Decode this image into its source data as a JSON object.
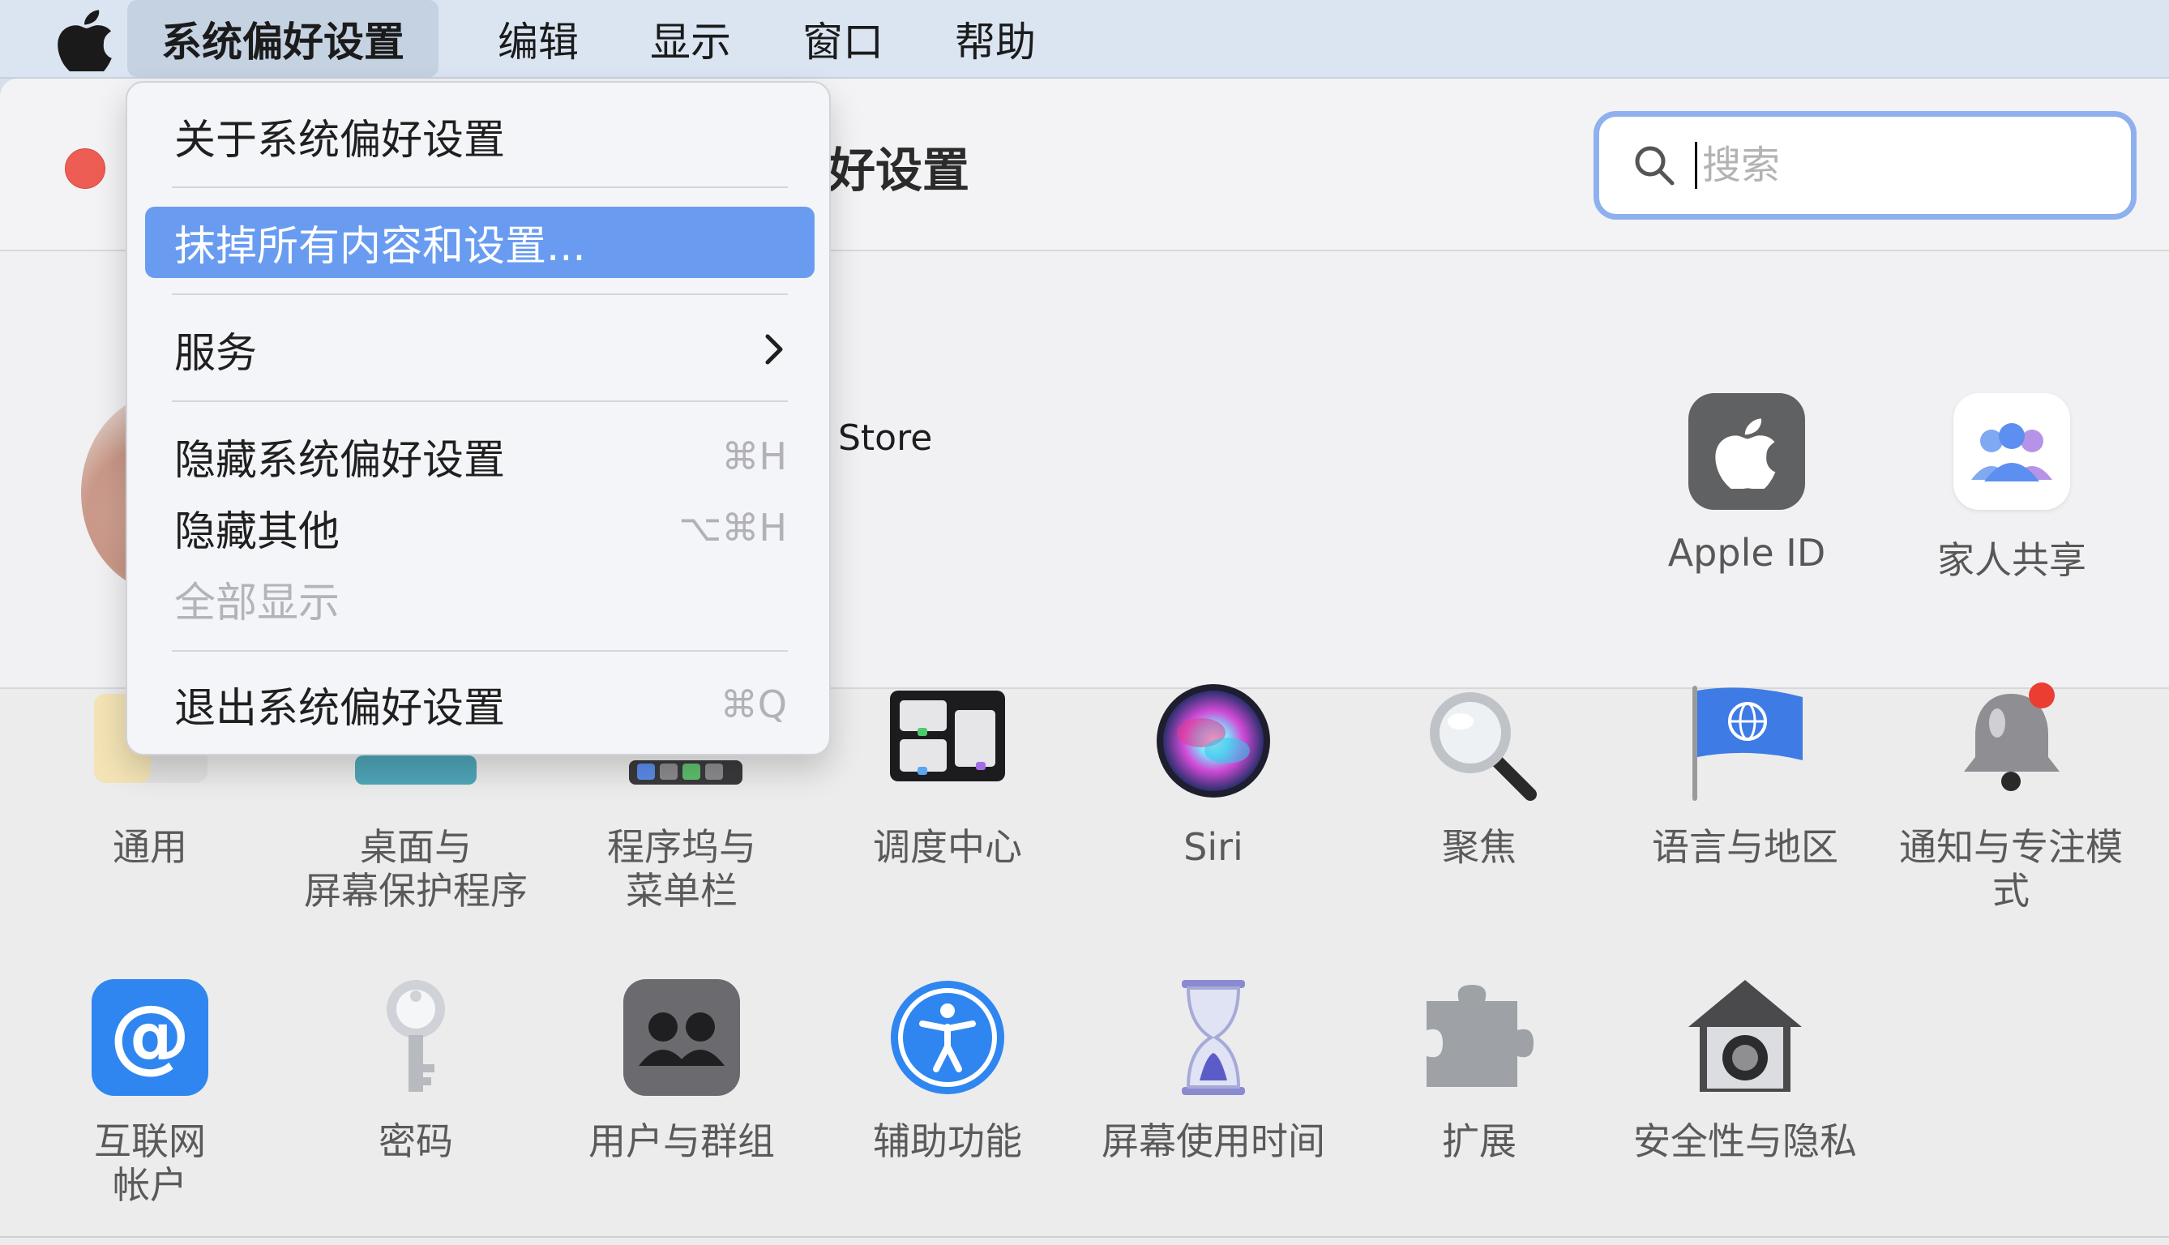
{
  "menubar": {
    "app_name": "系统偏好设置",
    "edit": "编辑",
    "view": "显示",
    "window": "窗口",
    "help": "帮助"
  },
  "window": {
    "title": "好设置",
    "search_placeholder": "搜索",
    "store_text": "Store"
  },
  "top_items": [
    {
      "label": "Apple ID",
      "icon": "apple-icon"
    },
    {
      "label": "家人共享",
      "icon": "family-sharing-icon"
    }
  ],
  "grid_row1": [
    {
      "label": "通用",
      "icon": "general-icon"
    },
    {
      "label": "桌面与\n屏幕保护程序",
      "icon": "desktop-screensaver-icon"
    },
    {
      "label": "程序坞与\n菜单栏",
      "icon": "dock-menubar-icon"
    },
    {
      "label": "调度中心",
      "icon": "mission-control-icon"
    },
    {
      "label": "Siri",
      "icon": "siri-icon"
    },
    {
      "label": "聚焦",
      "icon": "spotlight-icon"
    },
    {
      "label": "语言与地区",
      "icon": "language-region-icon"
    },
    {
      "label": "通知与专注模式",
      "icon": "notifications-icon"
    }
  ],
  "grid_row2": [
    {
      "label": "互联网\n帐户",
      "icon": "internet-accounts-icon"
    },
    {
      "label": "密码",
      "icon": "passwords-icon"
    },
    {
      "label": "用户与群组",
      "icon": "users-groups-icon"
    },
    {
      "label": "辅助功能",
      "icon": "accessibility-icon"
    },
    {
      "label": "屏幕使用时间",
      "icon": "screen-time-icon"
    },
    {
      "label": "扩展",
      "icon": "extensions-icon"
    },
    {
      "label": "安全性与隐私",
      "icon": "security-privacy-icon"
    }
  ],
  "dropdown": {
    "about": "关于系统偏好设置",
    "erase": "抹掉所有内容和设置...",
    "services": "服务",
    "hide": "隐藏系统偏好设置",
    "hide_shortcut": "⌘H",
    "hide_others": "隐藏其他",
    "hide_others_shortcut": "⌥⌘H",
    "show_all": "全部显示",
    "quit": "退出系统偏好设置",
    "quit_shortcut": "⌘Q"
  },
  "colors": {
    "menubar_bg": "#dbe5f2",
    "menu_highlight": "#699cf1",
    "search_ring": "#8fb0ee",
    "close_red": "#ee5d54"
  }
}
